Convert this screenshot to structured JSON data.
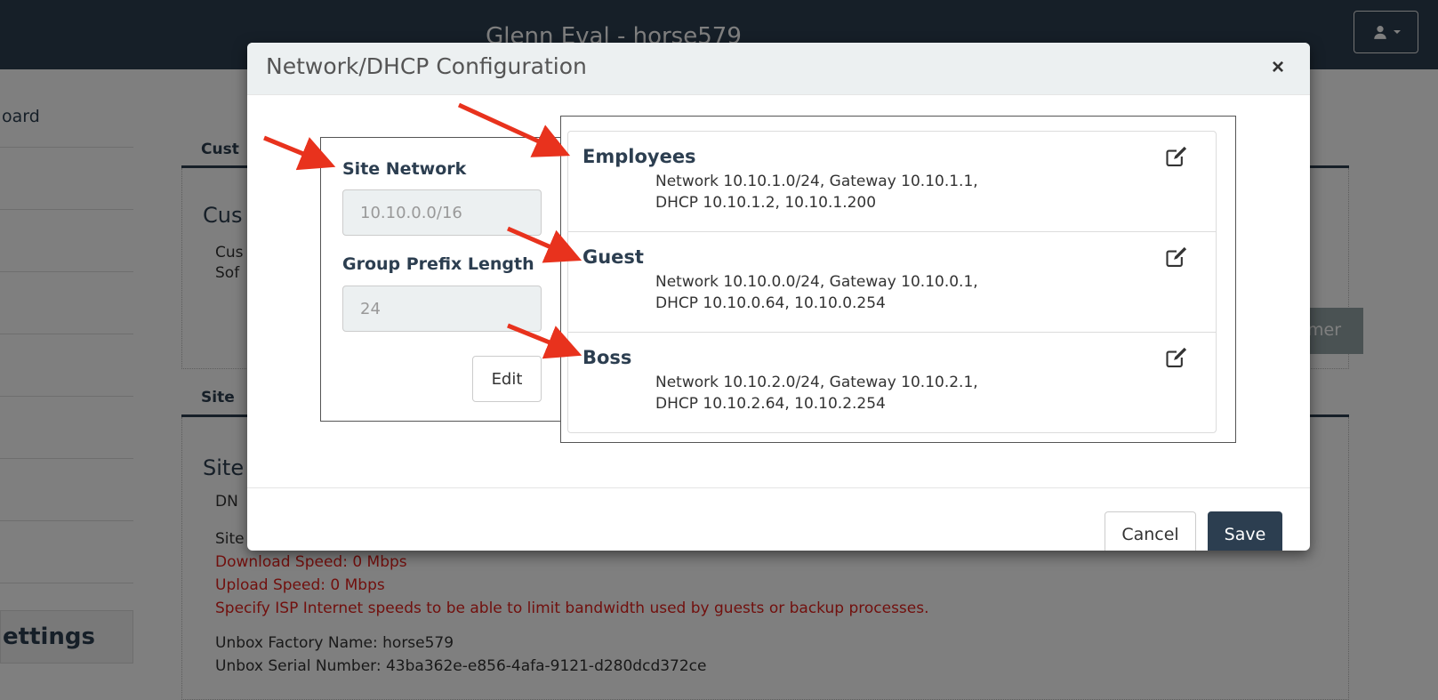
{
  "app": {
    "title": "Glenn Eval - horse579",
    "sidebar": {
      "items": [
        "oard",
        "",
        "",
        "",
        "",
        "",
        "",
        ""
      ],
      "settings_label": "ettings"
    },
    "panels": {
      "customer_tab": "Cust",
      "customer_heading": "Cus",
      "customer_line1": "Cus",
      "customer_line2": "Sof",
      "customer_button_fragment": "mer",
      "site_tab": "Site",
      "site_heading": "Site",
      "site_dns_fragment": "DN",
      "site_wan_label": "Site WAN IP Address:",
      "download_speed": "Download Speed: 0 Mbps",
      "upload_speed": "Upload Speed: 0 Mbps",
      "isp_note": "Specify ISP Internet speeds to be able to limit bandwidth used by guests or backup processes.",
      "factory_name": "Unbox Factory Name: horse579",
      "serial_number": "Unbox Serial Number: 43ba362e-e856-4afa-9121-d280dcd372ce"
    }
  },
  "modal": {
    "title": "Network/DHCP Configuration",
    "close_label": "×",
    "site_network": {
      "label": "Site Network",
      "value": "10.10.0.0/16"
    },
    "group_prefix": {
      "label": "Group Prefix Length",
      "value": "24"
    },
    "edit_label": "Edit",
    "groups": [
      {
        "name": "Employees",
        "network": "Network 10.10.1.0/24, Gateway 10.10.1.1,",
        "dhcp": "DHCP 10.10.1.2, 10.10.1.200"
      },
      {
        "name": "Guest",
        "network": "Network 10.10.0.0/24, Gateway 10.10.0.1,",
        "dhcp": "DHCP 10.10.0.64, 10.10.0.254"
      },
      {
        "name": "Boss",
        "network": "Network 10.10.2.0/24, Gateway 10.10.2.1,",
        "dhcp": "DHCP 10.10.2.64, 10.10.2.254"
      }
    ],
    "cancel_label": "Cancel",
    "save_label": "Save"
  },
  "icons": {
    "user": "user-icon",
    "edit": "pencil-square-icon",
    "arrow": "red-arrow-icon"
  },
  "colors": {
    "navbar": "#2c3e50",
    "primary": "#2c3e50",
    "modal_header": "#ecf0f1",
    "alert_text": "#e2211c",
    "annotation_arrow": "#e8321d"
  }
}
